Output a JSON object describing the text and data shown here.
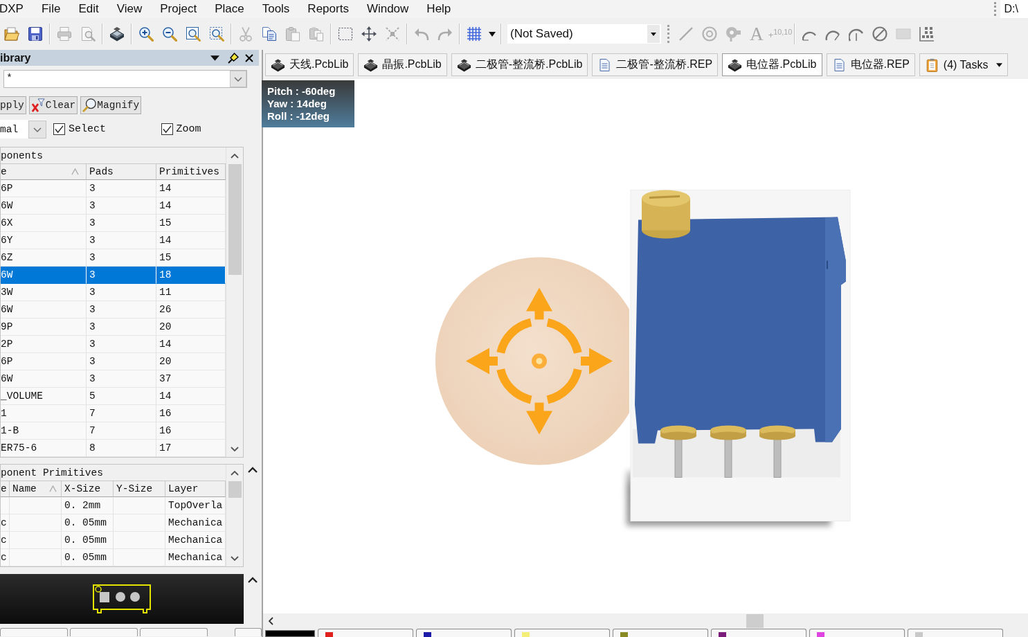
{
  "menu": [
    "DXP",
    "File",
    "Edit",
    "View",
    "Project",
    "Place",
    "Tools",
    "Reports",
    "Window",
    "Help"
  ],
  "path_field": {
    "value": "D:\\"
  },
  "toolbar": {
    "items": [
      {
        "kind": "open",
        "disabled": false
      },
      {
        "kind": "save",
        "disabled": false
      },
      {
        "kind": "separator"
      },
      {
        "kind": "print",
        "disabled": true
      },
      {
        "kind": "preview",
        "disabled": true
      },
      {
        "kind": "separator"
      },
      {
        "kind": "layers",
        "disabled": false
      },
      {
        "kind": "separator"
      },
      {
        "kind": "zoom-in",
        "disabled": false
      },
      {
        "kind": "zoom-out",
        "disabled": false
      },
      {
        "kind": "zoom-fit",
        "disabled": false
      },
      {
        "kind": "zoom-select",
        "disabled": false
      },
      {
        "kind": "separator"
      },
      {
        "kind": "cut",
        "disabled": true
      },
      {
        "kind": "copy",
        "disabled": false
      },
      {
        "kind": "paste",
        "disabled": true
      },
      {
        "kind": "paste-special",
        "disabled": true
      },
      {
        "kind": "separator"
      },
      {
        "kind": "select-rect",
        "disabled": false
      },
      {
        "kind": "move",
        "disabled": false
      },
      {
        "kind": "deselect",
        "disabled": true
      },
      {
        "kind": "separator"
      },
      {
        "kind": "undo",
        "disabled": true
      },
      {
        "kind": "redo",
        "disabled": true
      },
      {
        "kind": "separator"
      },
      {
        "kind": "grid",
        "disabled": false
      },
      {
        "kind": "caret",
        "disabled": false
      },
      {
        "kind": "separator"
      },
      {
        "kind": "combo",
        "value": "(Not Saved)"
      },
      {
        "kind": "grip"
      },
      {
        "kind": "line",
        "disabled": true
      },
      {
        "kind": "pad",
        "disabled": true
      },
      {
        "kind": "via",
        "disabled": true
      },
      {
        "kind": "text-tool",
        "text": "A",
        "disabled": true
      },
      {
        "kind": "coordinate-tool",
        "text": "+$^{10,10}$",
        "disabled": true
      },
      {
        "kind": "separator"
      },
      {
        "kind": "arc-center",
        "disabled": false
      },
      {
        "kind": "arc-edge",
        "disabled": false
      },
      {
        "kind": "arc-any",
        "disabled": false
      },
      {
        "kind": "circle",
        "disabled": false
      },
      {
        "kind": "fill-rect",
        "disabled": true
      },
      {
        "kind": "array",
        "disabled": false
      }
    ]
  },
  "library_panel": {
    "title": "ibrary",
    "mask_field": {
      "value": "*"
    },
    "buttons": [
      {
        "kind": "apply",
        "label": "pply"
      },
      {
        "kind": "clear",
        "label": "Clear"
      },
      {
        "kind": "magnify",
        "label": "Magnify"
      }
    ],
    "mode_dropdown": {
      "value": "mal"
    },
    "checkboxes": [
      {
        "label": "Select",
        "checked": true
      },
      {
        "label": "Zoom",
        "checked": true
      }
    ],
    "components": {
      "title": "ponents",
      "columns": [
        {
          "label": "e",
          "sorted": true
        },
        {
          "label": "Pads",
          "sorted": false
        },
        {
          "label": "Primitives",
          "sorted": false
        }
      ],
      "rows": [
        {
          "column_1": "6P",
          "pads": "3",
          "primitives": "14",
          "selected": false
        },
        {
          "column_1": "6W",
          "pads": "3",
          "primitives": "14",
          "selected": false
        },
        {
          "column_1": "6X",
          "pads": "3",
          "primitives": "15",
          "selected": false
        },
        {
          "column_1": "6Y",
          "pads": "3",
          "primitives": "14",
          "selected": false
        },
        {
          "column_1": "6Z",
          "pads": "3",
          "primitives": "15",
          "selected": false
        },
        {
          "column_1": "6W",
          "pads": "3",
          "primitives": "18",
          "selected": true
        },
        {
          "column_1": "3W",
          "pads": "3",
          "primitives": "11",
          "selected": false
        },
        {
          "column_1": "6W",
          "pads": "3",
          "primitives": "26",
          "selected": false
        },
        {
          "column_1": "9P",
          "pads": "3",
          "primitives": "20",
          "selected": false
        },
        {
          "column_1": "2P",
          "pads": "3",
          "primitives": "14",
          "selected": false
        },
        {
          "column_1": "6P",
          "pads": "3",
          "primitives": "20",
          "selected": false
        },
        {
          "column_1": "6W",
          "pads": "3",
          "primitives": "37",
          "selected": false
        },
        {
          "column_1": "_VOLUME",
          "pads": "5",
          "primitives": "14",
          "selected": false
        },
        {
          "column_1": "1",
          "pads": "7",
          "primitives": "16",
          "selected": false
        },
        {
          "column_1": "1-B",
          "pads": "7",
          "primitives": "16",
          "selected": false
        },
        {
          "column_1": "ER75-6",
          "pads": "8",
          "primitives": "17",
          "selected": false
        }
      ]
    },
    "primitives": {
      "title": "ponent Primitives",
      "columns": [
        {
          "label": "e",
          "sorted": false
        },
        {
          "label": "Name",
          "sorted": true
        },
        {
          "label": "X-Size",
          "sorted": false
        },
        {
          "label": "Y-Size",
          "sorted": false
        },
        {
          "label": "Layer",
          "sorted": false
        }
      ],
      "rows": [
        {
          "x_size": "0. 2mm",
          "layer": "TopOverla"
        },
        {
          "column_1": "c",
          "x_size": "0. 05mm",
          "layer": "Mechanica"
        },
        {
          "column_1": "c",
          "x_size": "0. 05mm",
          "layer": "Mechanica"
        },
        {
          "column_1": "c",
          "x_size": "0. 05mm",
          "layer": "Mechanica"
        }
      ]
    }
  },
  "document_tabs": [
    {
      "kind": "pcblib",
      "label": "天线.PcbLib",
      "selected": false
    },
    {
      "kind": "pcblib",
      "label": "晶振.PcbLib",
      "selected": false
    },
    {
      "kind": "pcblib",
      "label": "二极管-整流桥.PcbLib",
      "selected": false
    },
    {
      "kind": "rep",
      "label": "二极管-整流桥.REP",
      "selected": false
    },
    {
      "kind": "pcblib",
      "label": "电位器.PcbLib",
      "selected": true
    },
    {
      "kind": "rep",
      "label": "电位器.REP",
      "selected": false
    },
    {
      "kind": "tasks",
      "label": "(4) Tasks",
      "selected": false
    }
  ],
  "view": {
    "orientation": [
      "Pitch : -60deg",
      "Yaw : 14deg",
      "Roll : -12deg"
    ]
  },
  "current_layer": {
    "color": "#000000"
  },
  "layer_tabs": [
    {
      "color": "#e0201c"
    },
    {
      "color": "#1c1ca8"
    },
    {
      "color": "#f2ee78"
    },
    {
      "color": "#8a8a24"
    },
    {
      "color": "#7a1c7a"
    },
    {
      "color": "#e044e0"
    },
    {
      "color": "#c8c8c8"
    }
  ]
}
